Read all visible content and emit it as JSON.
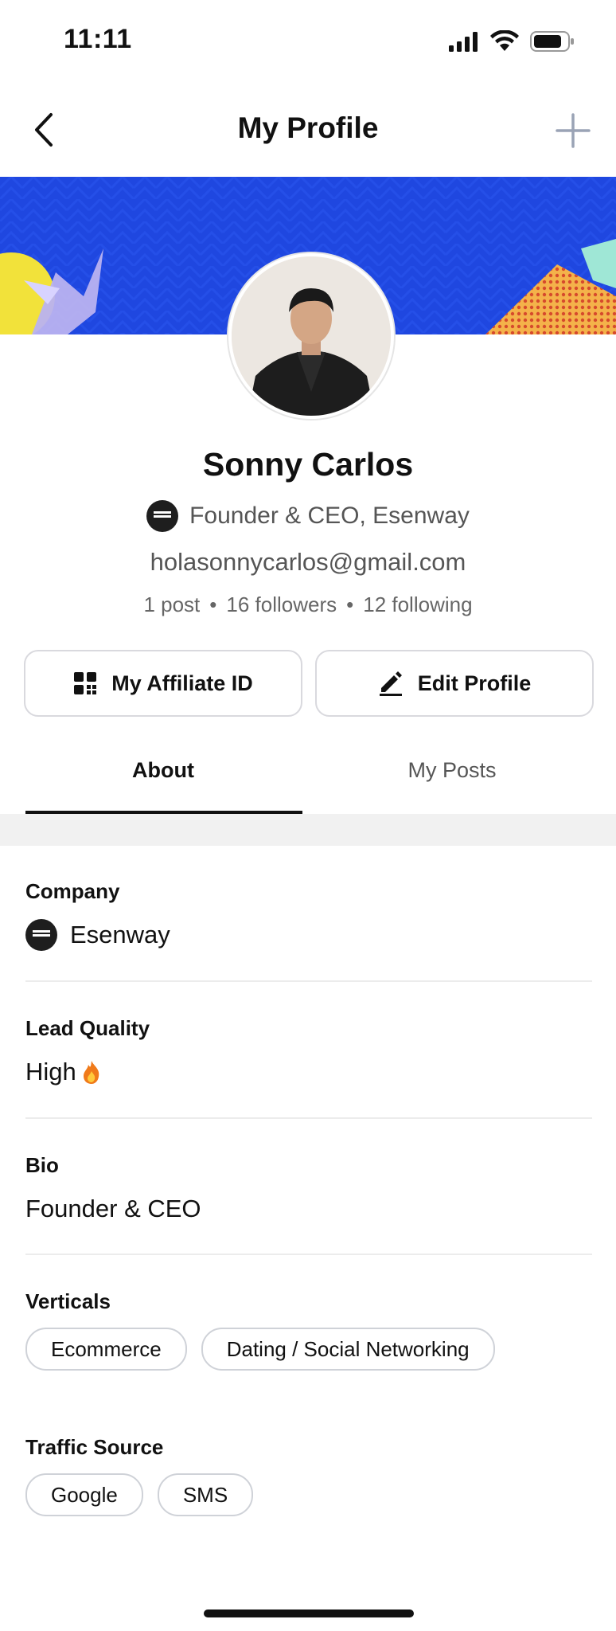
{
  "status_bar": {
    "time": "11:11"
  },
  "nav": {
    "title": "My Profile",
    "back_icon": "chevron-left-icon",
    "add_icon": "plus-icon"
  },
  "profile": {
    "name": "Sonny Carlos",
    "role": "Founder & CEO, Esenway",
    "email": "holasonnycarlos@gmail.com",
    "stats": {
      "posts": "1 post",
      "followers": "16 followers",
      "following": "12 following"
    }
  },
  "actions": {
    "affiliate_label": "My Affiliate ID",
    "edit_label": "Edit Profile"
  },
  "tabs": [
    {
      "label": "About",
      "active": true
    },
    {
      "label": "My Posts",
      "active": false
    }
  ],
  "about": {
    "company": {
      "label": "Company",
      "value": "Esenway"
    },
    "lead_quality": {
      "label": "Lead Quality",
      "value": "High",
      "emoji": "🔥"
    },
    "bio": {
      "label": "Bio",
      "value": "Founder & CEO"
    },
    "verticals": {
      "label": "Verticals",
      "chips": [
        "Ecommerce",
        "Dating / Social Networking"
      ]
    },
    "traffic_source": {
      "label": "Traffic Source",
      "chips": [
        "Google",
        "SMS"
      ]
    }
  },
  "colors": {
    "banner": "#1f47e0",
    "accent": "#111111",
    "muted": "#555555"
  }
}
